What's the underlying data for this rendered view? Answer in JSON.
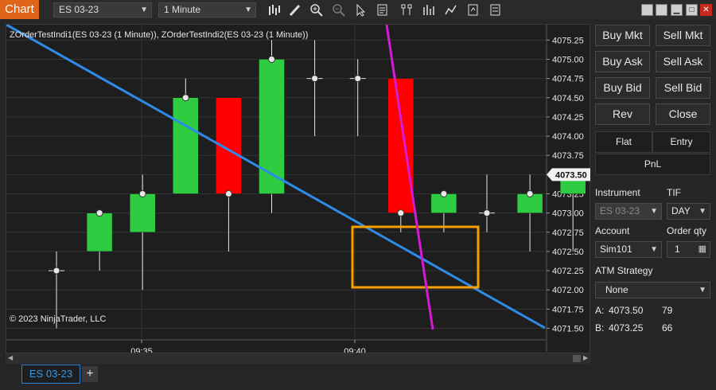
{
  "window": {
    "title": "Chart",
    "instrument": "ES 03-23",
    "interval": "1 Minute",
    "toolbar_icons": [
      "bar-type-icon",
      "pencil-icon",
      "zoom-in-icon",
      "zoom-out-icon",
      "pointer-icon",
      "data-box-icon",
      "indicators-icon",
      "strategies-icon",
      "drawing-tools-icon",
      "properties-icon",
      "chart-trader-icon"
    ],
    "window_buttons": [
      "minimize-icon",
      "restore-icon",
      "maximize-icon",
      "close-icon"
    ]
  },
  "chart": {
    "indicator_label": "ZOrderTestIndi1(ES 03-23 (1 Minute)), ZOrderTestIndi2(ES 03-23 (1 Minute))",
    "copyright": "© 2023 NinjaTrader, LLC",
    "price_labels": [
      "4075.25",
      "4075.00",
      "4074.75",
      "4074.50",
      "4074.25",
      "4074.00",
      "4073.75",
      "4073.50",
      "4073.25",
      "4073.00",
      "4072.75",
      "4072.50",
      "4072.25",
      "4072.00",
      "4071.75",
      "4071.50"
    ],
    "current_price": "4073.50",
    "time_labels": [
      "09:35",
      "09:40"
    ],
    "colors": {
      "up": "#2ecc40",
      "down": "#ff0000",
      "trendline": "#2f8be8",
      "magenta": "#d61ad6",
      "rect": "#f5a000",
      "bg": "#1e1e1e",
      "grid": "#333333"
    }
  },
  "chart_data": {
    "type": "candlestick",
    "x": [
      "09:33",
      "09:34",
      "09:35",
      "09:36",
      "09:37",
      "09:38",
      "09:39",
      "09:40",
      "09:41",
      "09:42",
      "09:43",
      "09:44",
      "09:45"
    ],
    "open": [
      4072.25,
      4072.5,
      4072.75,
      4073.25,
      4074.5,
      4073.25,
      4074.75,
      4074.75,
      4074.75,
      4073.0,
      4073.0,
      4073.0,
      4073.25
    ],
    "high": [
      4072.5,
      4073.0,
      4073.5,
      4074.75,
      4074.5,
      4075.25,
      4075.25,
      4075.0,
      4074.75,
      4073.0,
      4073.5,
      4073.5,
      4073.5
    ],
    "low": [
      4071.5,
      4072.25,
      4072.0,
      4073.25,
      4072.5,
      4073.0,
      4074.0,
      4074.0,
      4072.75,
      4072.75,
      4072.75,
      4072.5,
      4072.5
    ],
    "close": [
      4072.25,
      4073.0,
      4073.25,
      4074.5,
      4073.25,
      4075.0,
      4074.75,
      4074.75,
      4073.0,
      4073.25,
      4073.0,
      4073.25,
      4073.5
    ],
    "ylim": [
      4071.35,
      4075.45
    ]
  },
  "trader": {
    "buttons": {
      "buy_mkt": "Buy Mkt",
      "sell_mkt": "Sell Mkt",
      "buy_ask": "Buy Ask",
      "sell_ask": "Sell Ask",
      "buy_bid": "Buy Bid",
      "sell_bid": "Sell Bid",
      "rev": "Rev",
      "close": "Close"
    },
    "flat": "Flat",
    "entry": "Entry",
    "pnl": "PnL",
    "instrument_label": "Instrument",
    "instrument_value": "ES 03-23",
    "tif_label": "TIF",
    "tif_value": "DAY",
    "account_label": "Account",
    "account_value": "Sim101",
    "qty_label": "Order qty",
    "qty_value": "1",
    "atm_label": "ATM Strategy",
    "atm_value": "None",
    "ask_label": "A:",
    "ask_price": "4073.50",
    "ask_size": "79",
    "bid_label": "B:",
    "bid_price": "4073.25",
    "bid_size": "66"
  },
  "tabs": {
    "active": "ES 03-23",
    "add": "+"
  }
}
